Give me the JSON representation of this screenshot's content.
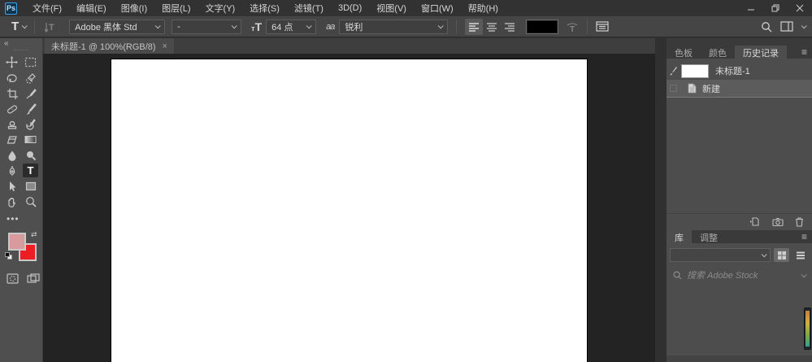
{
  "window": {
    "app_icon_text": "Ps",
    "controls": {
      "minimize": "minimize",
      "restore": "restore",
      "close": "close"
    }
  },
  "menu_bar": {
    "items": [
      "文件(F)",
      "编辑(E)",
      "图像(I)",
      "图层(L)",
      "文字(Y)",
      "选择(S)",
      "滤镜(T)",
      "3D(D)",
      "视图(V)",
      "窗口(W)",
      "帮助(H)"
    ]
  },
  "options_bar": {
    "type_tool_glyph": "T",
    "size_glyph_small": "т",
    "size_glyph_large": "T",
    "anti_alias_glyph": "aa",
    "font_family_value": "Adobe 黑体 Std",
    "font_style_value": "-",
    "font_size_value": "64 点",
    "anti_alias_value": "锐利",
    "text_color_hex": "#000000"
  },
  "document_tab": {
    "title": "未标题-1 @ 100%(RGB/8)",
    "close_glyph": "×"
  },
  "tools_panel": {
    "collapse_glyph": "«",
    "ellipsis_glyph": "•••",
    "swap_glyph": "⇄",
    "active_tool": "type-tool",
    "type_tool_glyph": "T",
    "foreground_color": "#d99a9e",
    "background_color": "#ee1d24",
    "tool_names": [
      "move-tool",
      "marquee-tool",
      "lasso-tool",
      "quick-selection-tool",
      "crop-tool",
      "eyedropper-tool",
      "healing-brush-tool",
      "brush-tool",
      "clone-stamp-tool",
      "history-brush-tool",
      "eraser-tool",
      "gradient-tool",
      "blur-tool",
      "dodge-tool",
      "pen-tool",
      "type-tool",
      "path-selection-tool",
      "rectangle-tool",
      "hand-tool",
      "zoom-tool"
    ]
  },
  "panels": {
    "group1": {
      "tabs": [
        "色板",
        "颜色",
        "历史记录"
      ],
      "active_tab": "历史记录",
      "menu_glyph": "≡",
      "history": {
        "snapshot_label": "未标题-1",
        "state_label": "新建"
      }
    },
    "group2": {
      "tabs": [
        "库",
        "调整"
      ],
      "active_tab": "库",
      "menu_glyph": "≡",
      "search_placeholder": "搜索 Adobe Stock"
    }
  },
  "edge_strip_colors": [
    "#c87f3e",
    "#cdb03f",
    "#86a93f",
    "#35a08c"
  ]
}
